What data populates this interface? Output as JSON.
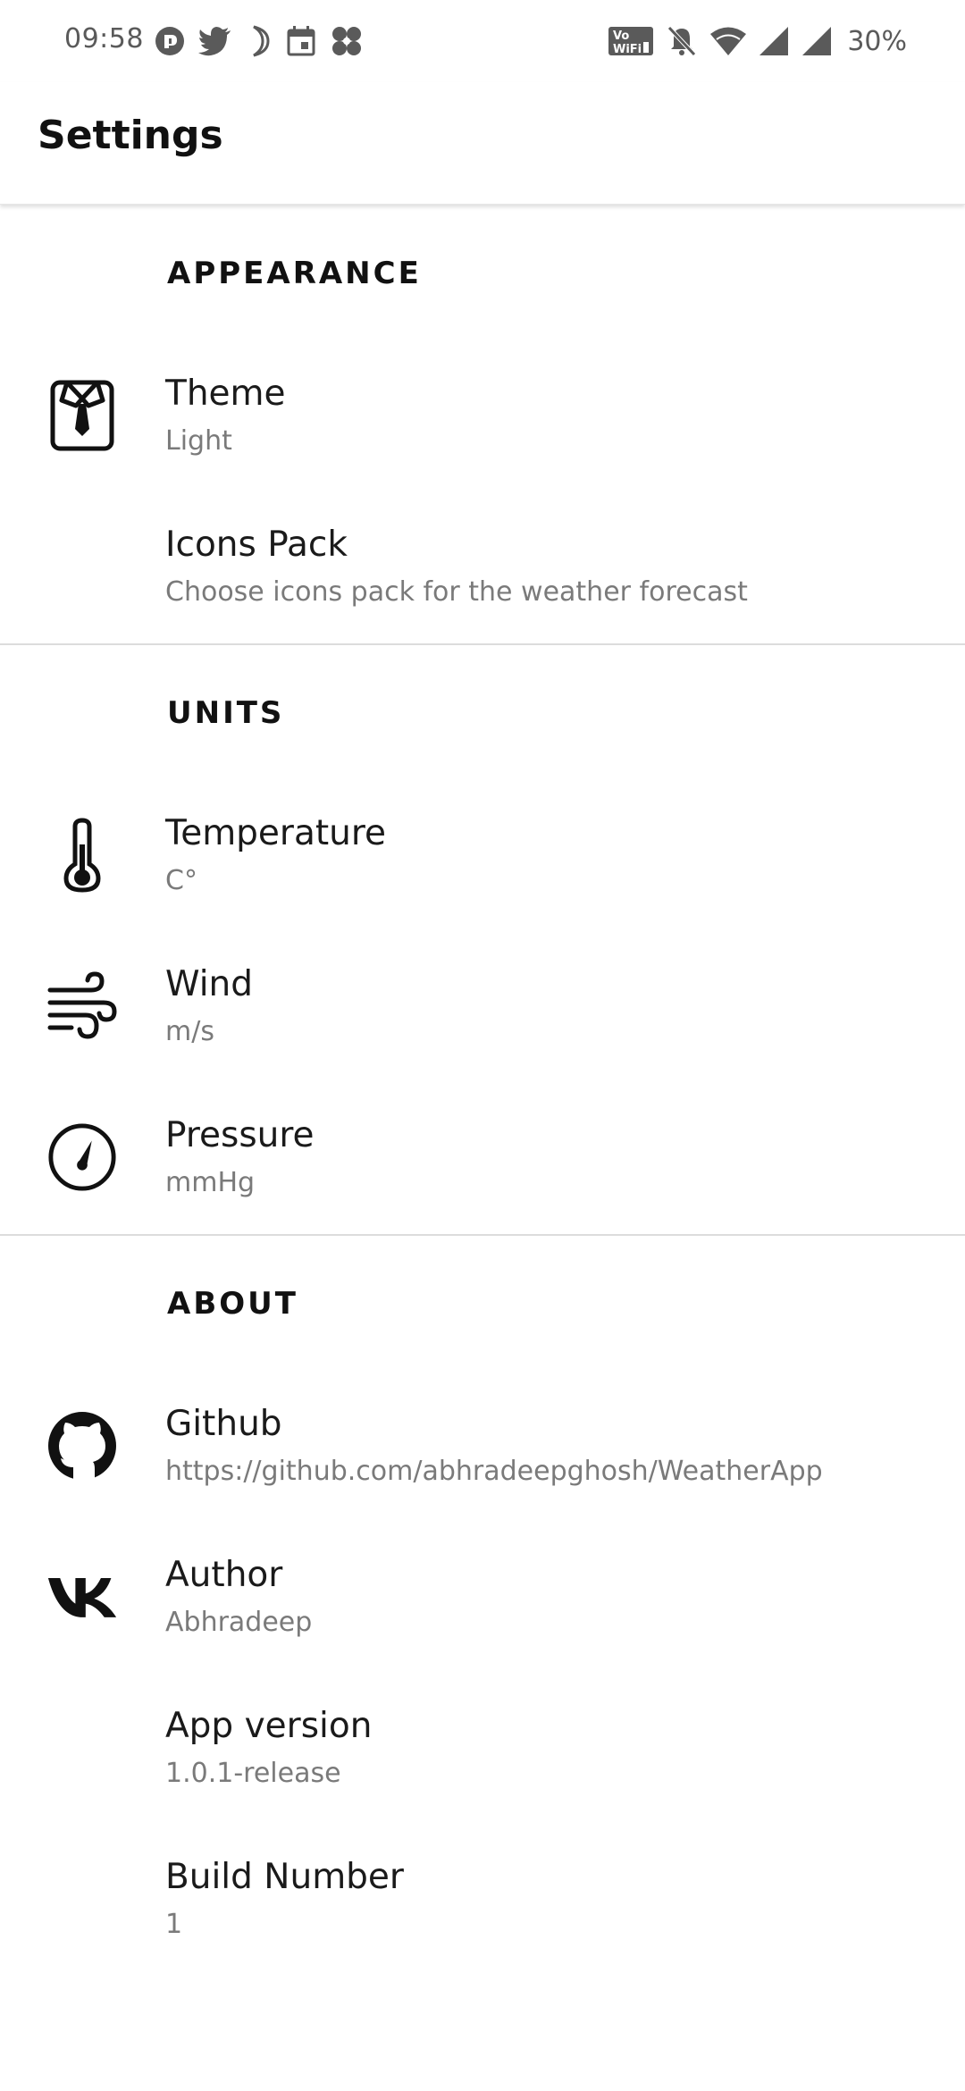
{
  "status_bar": {
    "time": "09:58",
    "battery": "30%",
    "left_icons": [
      "messenger-icon",
      "twitter-icon",
      "moon-icon",
      "calendar-icon",
      "fan-icon"
    ],
    "right_icons": [
      "vowifi-icon",
      "bell-off-icon",
      "wifi-icon",
      "signal-icon",
      "signal-icon"
    ]
  },
  "appbar": {
    "title": "Settings"
  },
  "sections": {
    "appearance": {
      "header": "APPEARANCE",
      "items": [
        {
          "title": "Theme",
          "subtitle": "Light",
          "icon": "shirt-tie-icon"
        },
        {
          "title": "Icons Pack",
          "subtitle": "Choose icons pack for the weather forecast",
          "icon": ""
        }
      ]
    },
    "units": {
      "header": "UNITS",
      "items": [
        {
          "title": "Temperature",
          "subtitle": "C°",
          "icon": "thermometer-icon"
        },
        {
          "title": "Wind",
          "subtitle": "m/s",
          "icon": "wind-icon"
        },
        {
          "title": "Pressure",
          "subtitle": "mmHg",
          "icon": "gauge-icon"
        }
      ]
    },
    "about": {
      "header": "ABOUT",
      "items": [
        {
          "title": "Github",
          "subtitle": "https://github.com/abhradeepghosh/WeatherApp",
          "icon": "github-icon"
        },
        {
          "title": "Author",
          "subtitle": "Abhradeep",
          "icon": "vk-icon"
        },
        {
          "title": "App version",
          "subtitle": "1.0.1-release",
          "icon": ""
        },
        {
          "title": "Build Number",
          "subtitle": "1",
          "icon": ""
        }
      ]
    }
  }
}
